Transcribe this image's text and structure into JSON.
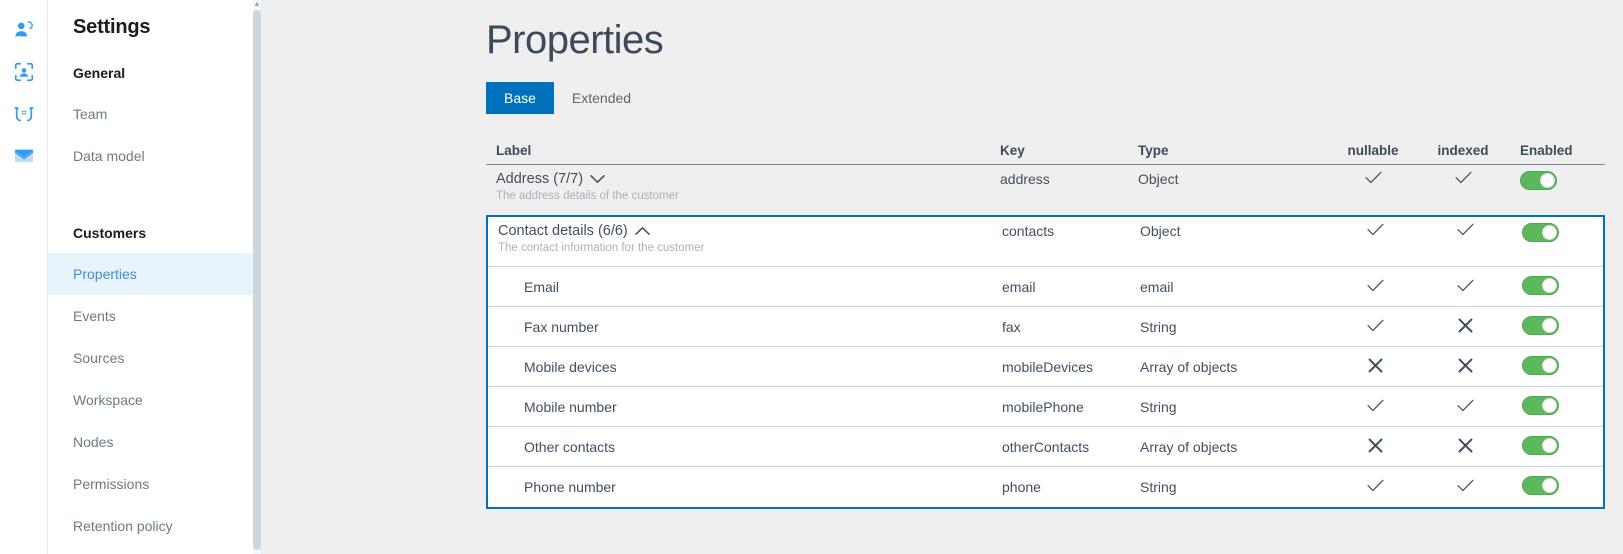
{
  "rail": {
    "icons": [
      {
        "name": "user-add-icon",
        "title": "Profiles"
      },
      {
        "name": "identity-scan-icon",
        "title": "Identity"
      },
      {
        "name": "link-connect-icon",
        "title": "Connections"
      },
      {
        "name": "envelope-icon",
        "title": "Messages"
      }
    ]
  },
  "sidebar": {
    "title": "Settings",
    "groups": [
      {
        "label": "General",
        "items": [
          {
            "label": "Team",
            "active": false
          },
          {
            "label": "Data model",
            "active": false
          }
        ]
      },
      {
        "label": "Customers",
        "items": [
          {
            "label": "Properties",
            "active": true
          },
          {
            "label": "Events",
            "active": false
          },
          {
            "label": "Sources",
            "active": false
          },
          {
            "label": "Workspace",
            "active": false
          },
          {
            "label": "Nodes",
            "active": false
          },
          {
            "label": "Permissions",
            "active": false
          },
          {
            "label": "Retention policy",
            "active": false
          }
        ]
      }
    ]
  },
  "main": {
    "title": "Properties",
    "tabs": [
      {
        "label": "Base",
        "active": true
      },
      {
        "label": "Extended",
        "active": false
      }
    ],
    "table": {
      "columns": {
        "label": "Label",
        "key": "Key",
        "type": "Type",
        "nullable": "nullable",
        "indexed": "indexed",
        "enabled": "Enabled"
      },
      "groups": [
        {
          "label": "Address (7/7)",
          "description": "The address details of the customer",
          "key": "address",
          "type": "Object",
          "expanded": false,
          "chevron": "chevron-down-icon",
          "nullable": true,
          "indexed": true,
          "enabled": true,
          "children": []
        },
        {
          "label": "Contact details (6/6)",
          "description": "The contact information for the customer",
          "key": "contacts",
          "type": "Object",
          "expanded": true,
          "chevron": "chevron-up-icon",
          "nullable": true,
          "indexed": true,
          "enabled": true,
          "children": [
            {
              "label": "Email",
              "key": "email",
              "type": "email",
              "nullable": true,
              "indexed": true,
              "enabled": true
            },
            {
              "label": "Fax number",
              "key": "fax",
              "type": "String",
              "nullable": true,
              "indexed": false,
              "enabled": true
            },
            {
              "label": "Mobile devices",
              "key": "mobileDevices",
              "type": "Array of objects",
              "nullable": false,
              "indexed": false,
              "enabled": true
            },
            {
              "label": "Mobile number",
              "key": "mobilePhone",
              "type": "String",
              "nullable": true,
              "indexed": true,
              "enabled": true
            },
            {
              "label": "Other contacts",
              "key": "otherContacts",
              "type": "Array of objects",
              "nullable": false,
              "indexed": false,
              "enabled": true
            },
            {
              "label": "Phone number",
              "key": "phone",
              "type": "String",
              "nullable": true,
              "indexed": true,
              "enabled": true
            }
          ]
        }
      ]
    }
  },
  "colors": {
    "accent": "#0071bc",
    "accent_light": "#1890f2",
    "toggle_on": "#5cb85c",
    "active_nav_bg": "#e8f4fd",
    "page_bg": "#efefef",
    "text": "#41505f",
    "muted": "#a8b3bd"
  }
}
